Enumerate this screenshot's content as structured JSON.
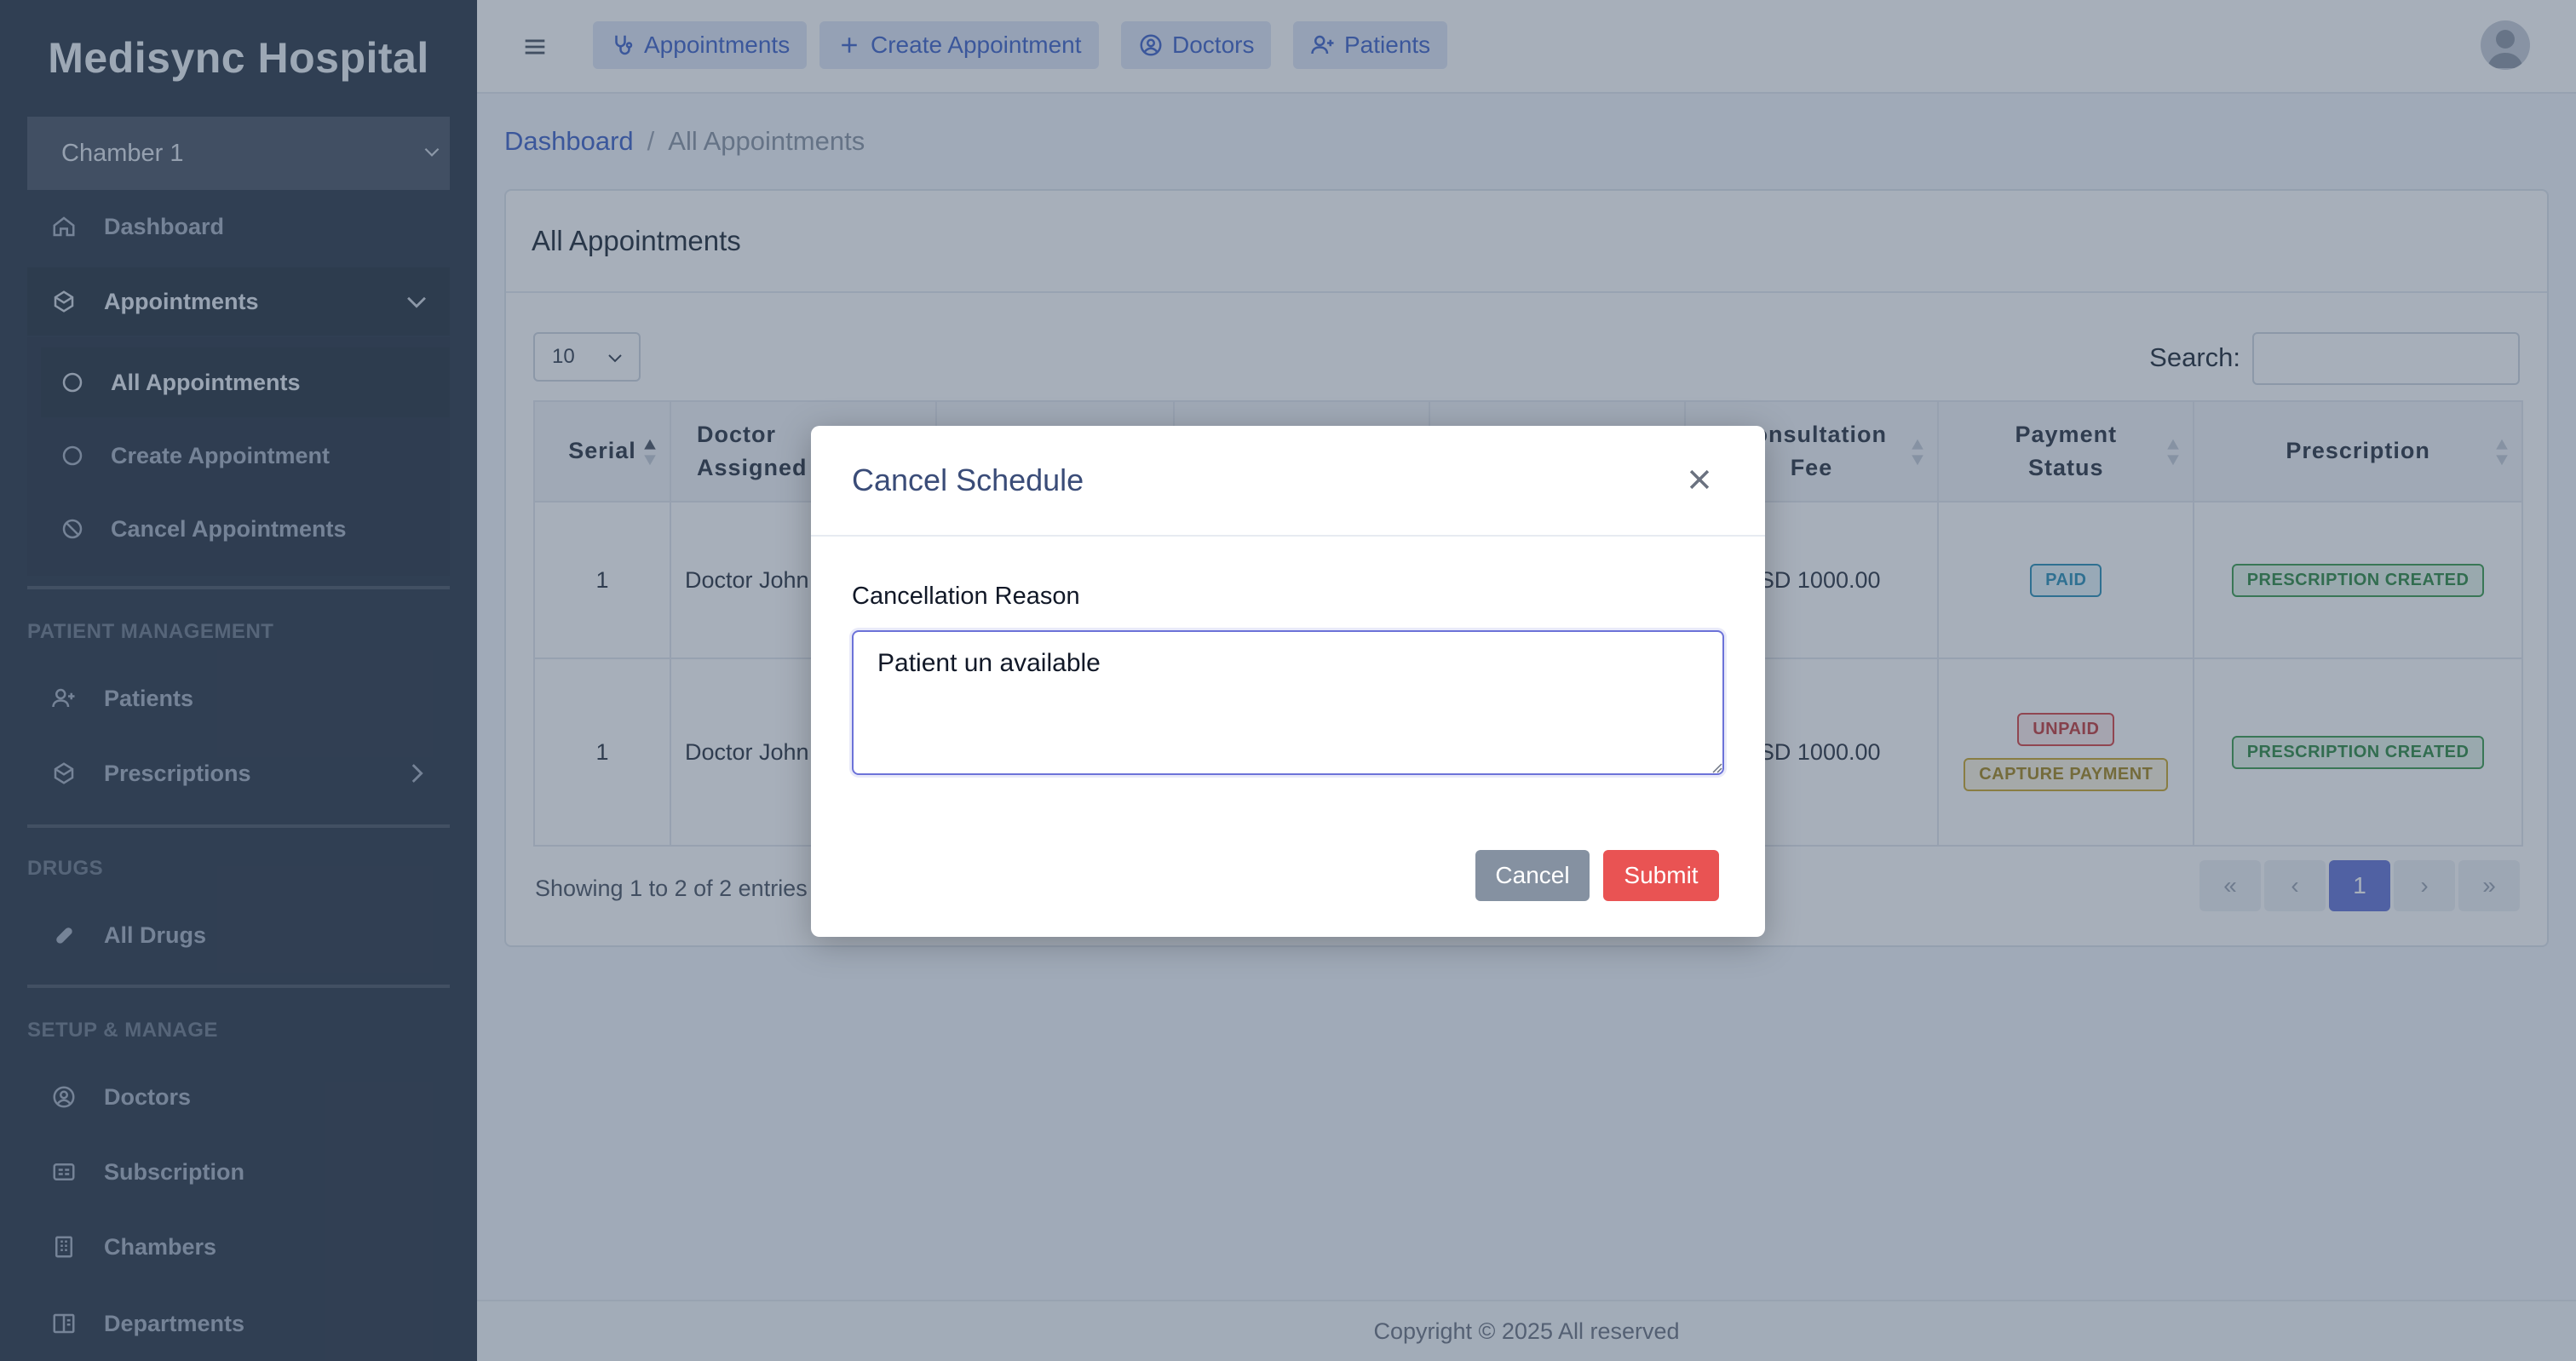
{
  "brand": "Medisync Hospital",
  "chamber_select": "Chamber 1",
  "sidebar": {
    "dashboard": "Dashboard",
    "appointments": "Appointments",
    "sub_items": [
      "All Appointments",
      "Create Appointment",
      "Cancel Appointments"
    ],
    "section_patient": "PATIENT MANAGEMENT",
    "patients": "Patients",
    "prescriptions": "Prescriptions",
    "section_drugs": "DRUGS",
    "all_drugs": "All Drugs",
    "section_setup": "SETUP & MANAGE",
    "doctors": "Doctors",
    "subscription": "Subscription",
    "chambers": "Chambers",
    "departments": "Departments"
  },
  "topbar": {
    "buttons": [
      "Appointments",
      "Create Appointment",
      "Doctors",
      "Patients"
    ]
  },
  "breadcrumb": {
    "home": "Dashboard",
    "separator": "/",
    "current": "All Appointments"
  },
  "card": {
    "title": "All Appointments",
    "page_length": "10",
    "search_label": "Search:",
    "search_value": ""
  },
  "table": {
    "headers": {
      "serial": "Serial",
      "doctor": [
        "Doctor",
        "Assigned"
      ],
      "fee": [
        "Consultation",
        "Fee"
      ],
      "payment": [
        "Payment",
        "Status"
      ],
      "prescription": "Prescription"
    },
    "rows": [
      {
        "serial": "1",
        "doctor": "Doctor John",
        "fee": "USD 1000.00",
        "payment": [
          "PAID"
        ],
        "prescription": "PRESCRIPTION CREATED"
      },
      {
        "serial": "1",
        "doctor": "Doctor John",
        "fee": "USD 1000.00",
        "payment": [
          "UNPAID",
          "CAPTURE PAYMENT"
        ],
        "prescription": "PRESCRIPTION CREATED"
      }
    ]
  },
  "showing": "Showing 1 to 2 of 2 entries",
  "pagination": {
    "first": "«",
    "prev": "‹",
    "current": "1",
    "next": "›",
    "last": "»"
  },
  "footer": "Copyright © 2025 All reserved",
  "modal": {
    "title": "Cancel Schedule",
    "label": "Cancellation Reason",
    "reason_value": "Patient un available",
    "cancel_label": "Cancel",
    "submit_label": "Submit"
  },
  "colors": {
    "sidebar_bg": "#2c3848",
    "accent": "#3f63c8",
    "submit": "#e95353",
    "pager_active": "#6574d6"
  }
}
